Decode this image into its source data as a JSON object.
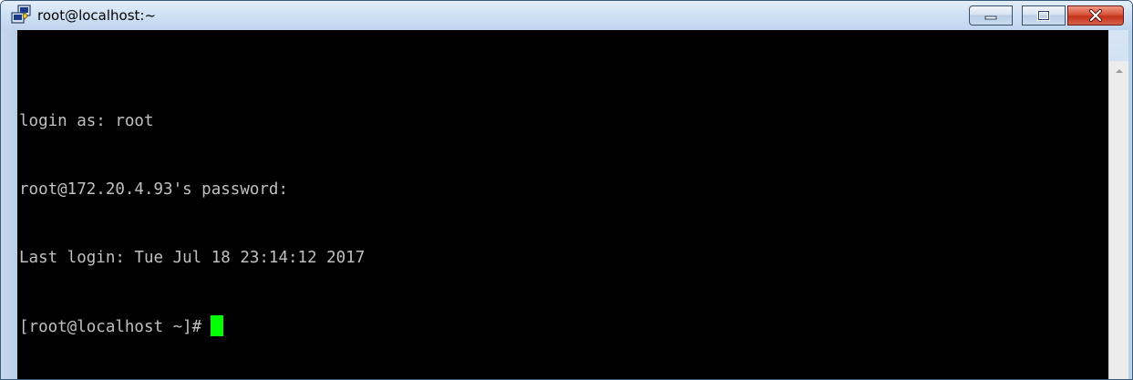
{
  "window": {
    "title": "root@localhost:~",
    "icon": "putty-icon"
  },
  "controls": {
    "minimize": "minimize-icon",
    "maximize": "maximize-icon",
    "close": "close-icon"
  },
  "terminal": {
    "lines": [
      "login as: root",
      "root@172.20.4.93's password:",
      "Last login: Tue Jul 18 23:14:12 2017",
      "[root@localhost ~]#"
    ],
    "background": "#000000",
    "text_color": "#c0c0c0",
    "cursor_color": "#00ff00"
  },
  "scrollbar": {
    "up_arrow": "scroll-up-arrow-icon"
  }
}
